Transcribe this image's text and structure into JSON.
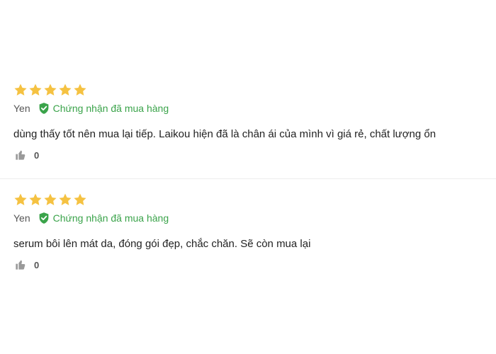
{
  "colors": {
    "star": "#f5c242",
    "verified": "#3aa34a",
    "thumb": "#9a9a9a"
  },
  "reviews": [
    {
      "rating": 5,
      "author": "Yen",
      "verified_label": "Chứng nhận đã mua hàng",
      "content": "dùng thấy tốt nên mua lại tiếp. Laikou hiện đã là chân ái của mình vì giá rẻ, chất lượng ổn",
      "likes": "0",
      "icons": {
        "star": "star-icon",
        "verified": "verified-check-icon",
        "like": "thumbs-up-icon"
      }
    },
    {
      "rating": 5,
      "author": "Yen",
      "verified_label": "Chứng nhận đã mua hàng",
      "content": "serum bôi lên mát da, đóng gói đẹp, chắc chăn. Sẽ còn mua lại",
      "likes": "0",
      "icons": {
        "star": "star-icon",
        "verified": "verified-check-icon",
        "like": "thumbs-up-icon"
      }
    }
  ]
}
